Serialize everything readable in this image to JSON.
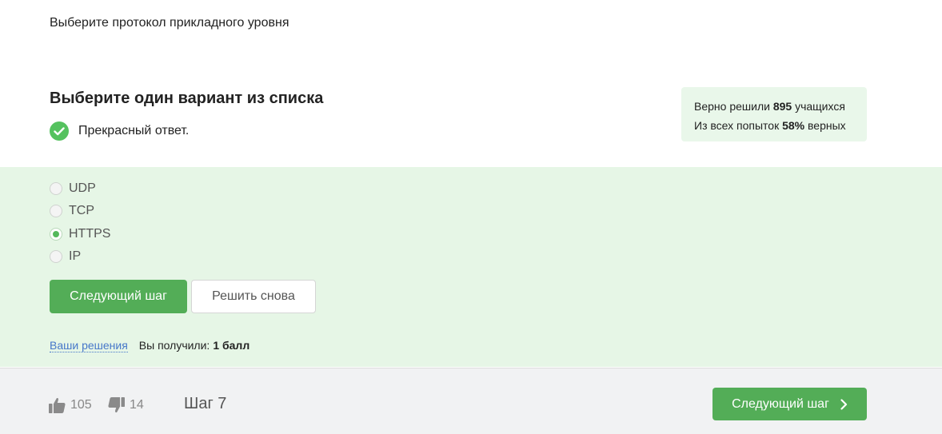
{
  "question": {
    "text": "Выберите протокол прикладного уровня"
  },
  "quiz": {
    "header": "Выберите один вариант из списка",
    "feedback": "Прекрасный ответ."
  },
  "stats": {
    "solved_prefix": "Верно решили",
    "solved_count": "895",
    "solved_suffix": "учащихся",
    "attempts_prefix": "Из всех попыток",
    "attempts_percent": "58%",
    "attempts_suffix": "верных"
  },
  "options": [
    {
      "label": "UDP",
      "selected": false
    },
    {
      "label": "TCP",
      "selected": false
    },
    {
      "label": "HTTPS",
      "selected": true
    },
    {
      "label": "IP",
      "selected": false
    }
  ],
  "buttons": {
    "next_step": "Следующий шаг",
    "retry": "Решить снова"
  },
  "result": {
    "solutions_link": "Ваши решения",
    "score_prefix": "Вы получили:",
    "score_value": "1 балл"
  },
  "footer": {
    "likes": "105",
    "dislikes": "14",
    "step": "Шаг 7",
    "next_label": "Следующий шаг"
  },
  "colors": {
    "accent_green": "#53ad57",
    "panel_green": "#e6f6e6",
    "stats_green": "#e9f7ea",
    "link_blue": "#4677c9"
  },
  "icons": {
    "feedback": "check-circle-icon",
    "like": "thumbs-up-icon",
    "dislike": "thumbs-down-icon",
    "next": "chevron-right-icon"
  }
}
